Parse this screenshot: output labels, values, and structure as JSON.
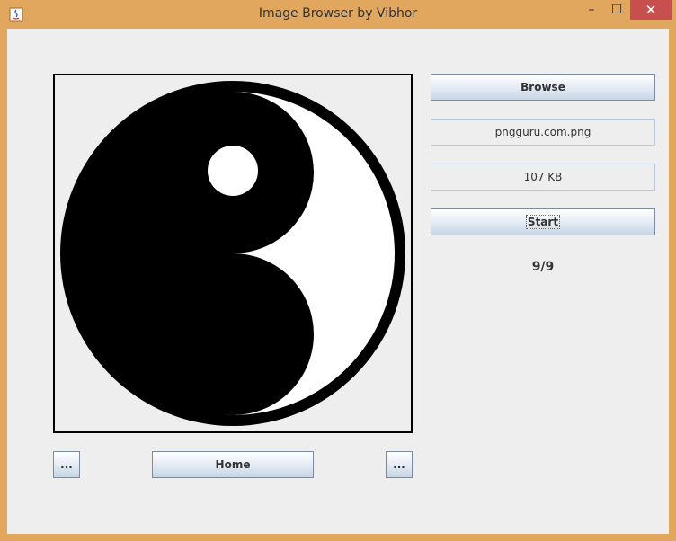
{
  "window": {
    "title": "Image Browser by Vibhor",
    "controls": {
      "minimize": "–",
      "maximize": "☐",
      "close": "✕"
    }
  },
  "image": {
    "icon": "yin-yang-icon"
  },
  "buttons": {
    "browse": "Browse",
    "start": "Start",
    "prev": "...",
    "home": "Home",
    "next": "..."
  },
  "info": {
    "filename": "pngguru.com.png",
    "filesize": "107 KB",
    "counter": "9/9"
  },
  "colors": {
    "frame": "#e2a75f",
    "close_button": "#c7504f",
    "client_bg": "#eeeeee"
  }
}
